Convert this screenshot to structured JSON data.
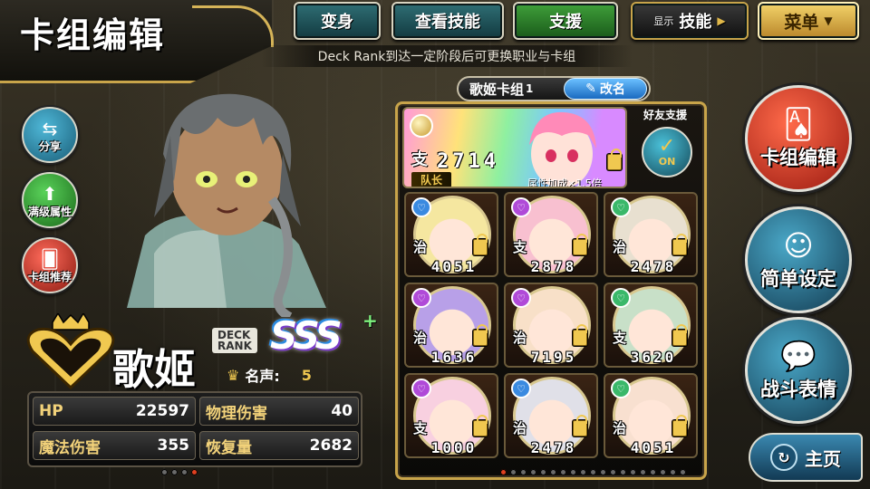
{
  "header": {
    "title": "卡组编辑",
    "buttons": {
      "transform": "变身",
      "view_skills": "查看技能",
      "support": "支援",
      "display_small": "显示",
      "display_value": "技能",
      "menu": "菜单"
    },
    "notice": "Deck Rank到达一定阶段后可更换职业与卡组"
  },
  "left_buttons": {
    "share": "分享",
    "max_attr": "满级属性",
    "deck_recommend": "卡组推荐"
  },
  "deck_class": {
    "name": "歌姬",
    "deck_rank_label_1": "DECK",
    "deck_rank_label_2": "RANK",
    "rank": "SSS",
    "rank_plus": "+",
    "fame_label": "名声:",
    "fame_value": "5"
  },
  "stats": {
    "hp_label": "HP",
    "hp_value": "22597",
    "phys_label": "物理伤害",
    "phys_value": "40",
    "magic_label": "魔法伤害",
    "magic_value": "355",
    "heal_label": "恢复量",
    "heal_value": "2682"
  },
  "deck": {
    "title": "歌姬卡组",
    "number": "1",
    "rename": "改名",
    "leader": {
      "role": "支",
      "power": "2714",
      "captain_label": "队长",
      "bonus": "属性加成×1.5倍"
    },
    "friend_support_label": "好友支援",
    "friend_support_state": "ON",
    "cards": [
      {
        "role": "治",
        "power": "4051",
        "attr_color": "#3a8ae0"
      },
      {
        "role": "支",
        "power": "2878",
        "attr_color": "#b04ad8"
      },
      {
        "role": "治",
        "power": "2478",
        "attr_color": "#3ab86a"
      },
      {
        "role": "治",
        "power": "1636",
        "attr_color": "#b04ad8"
      },
      {
        "role": "治",
        "power": "7195",
        "attr_color": "#b04ad8"
      },
      {
        "role": "支",
        "power": "3620",
        "attr_color": "#3ab86a"
      },
      {
        "role": "支",
        "power": "1000",
        "attr_color": "#b04ad8"
      },
      {
        "role": "治",
        "power": "2478",
        "attr_color": "#3a8ae0"
      },
      {
        "role": "治",
        "power": "4051",
        "attr_color": "#3ab86a"
      }
    ]
  },
  "right_buttons": {
    "deck_edit": "卡组编辑",
    "simple_settings": "简单设定",
    "battle_emote": "战斗表情",
    "home": "主页"
  }
}
